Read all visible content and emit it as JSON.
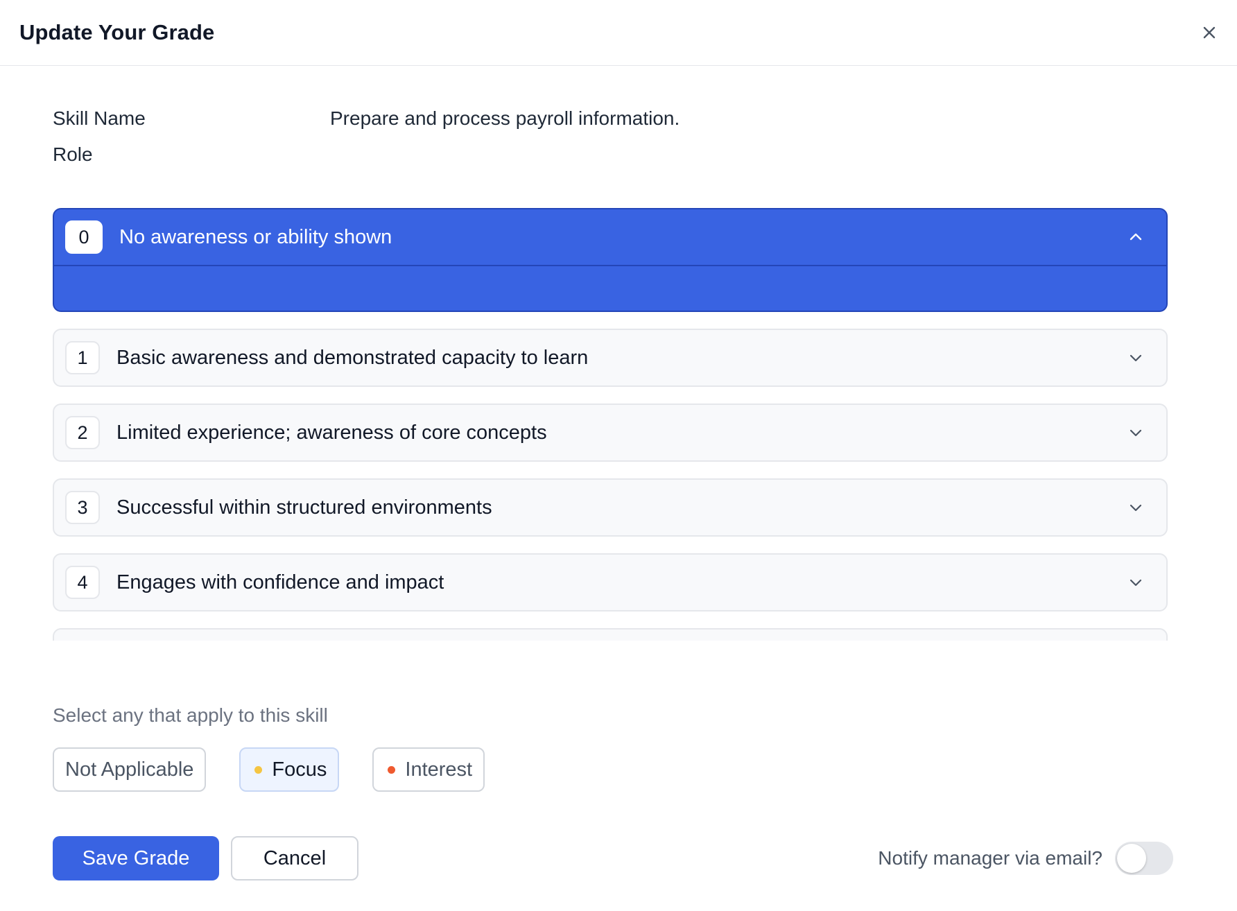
{
  "dialog": {
    "title": "Update Your Grade"
  },
  "info": {
    "skill_label": "Skill Name",
    "skill_value": "Prepare and process payroll information.",
    "role_label": "Role",
    "role_value": ""
  },
  "levels": [
    {
      "number": "0",
      "label": "No awareness or ability shown",
      "expanded": true
    },
    {
      "number": "1",
      "label": "Basic awareness and demonstrated capacity to learn",
      "expanded": false
    },
    {
      "number": "2",
      "label": "Limited experience; awareness of core concepts",
      "expanded": false
    },
    {
      "number": "3",
      "label": "Successful within structured environments",
      "expanded": false
    },
    {
      "number": "4",
      "label": "Engages with confidence and impact",
      "expanded": false
    }
  ],
  "tags": {
    "title": "Select any that apply to this skill",
    "options": [
      {
        "label": "Not Applicable",
        "selected": false,
        "dot_color": ""
      },
      {
        "label": "Focus",
        "selected": true,
        "dot_color": "#f5c542"
      },
      {
        "label": "Interest",
        "selected": false,
        "dot_color": "#ef5a2f"
      }
    ]
  },
  "footer": {
    "save_label": "Save Grade",
    "cancel_label": "Cancel",
    "notify_label": "Notify manager via email?",
    "notify_enabled": false
  },
  "icons": {
    "close": "close-icon",
    "expand": "chevron-down-icon",
    "collapse": "chevron-up-icon"
  },
  "colors": {
    "accent": "#3963e2",
    "accent_border": "#2446b8"
  }
}
